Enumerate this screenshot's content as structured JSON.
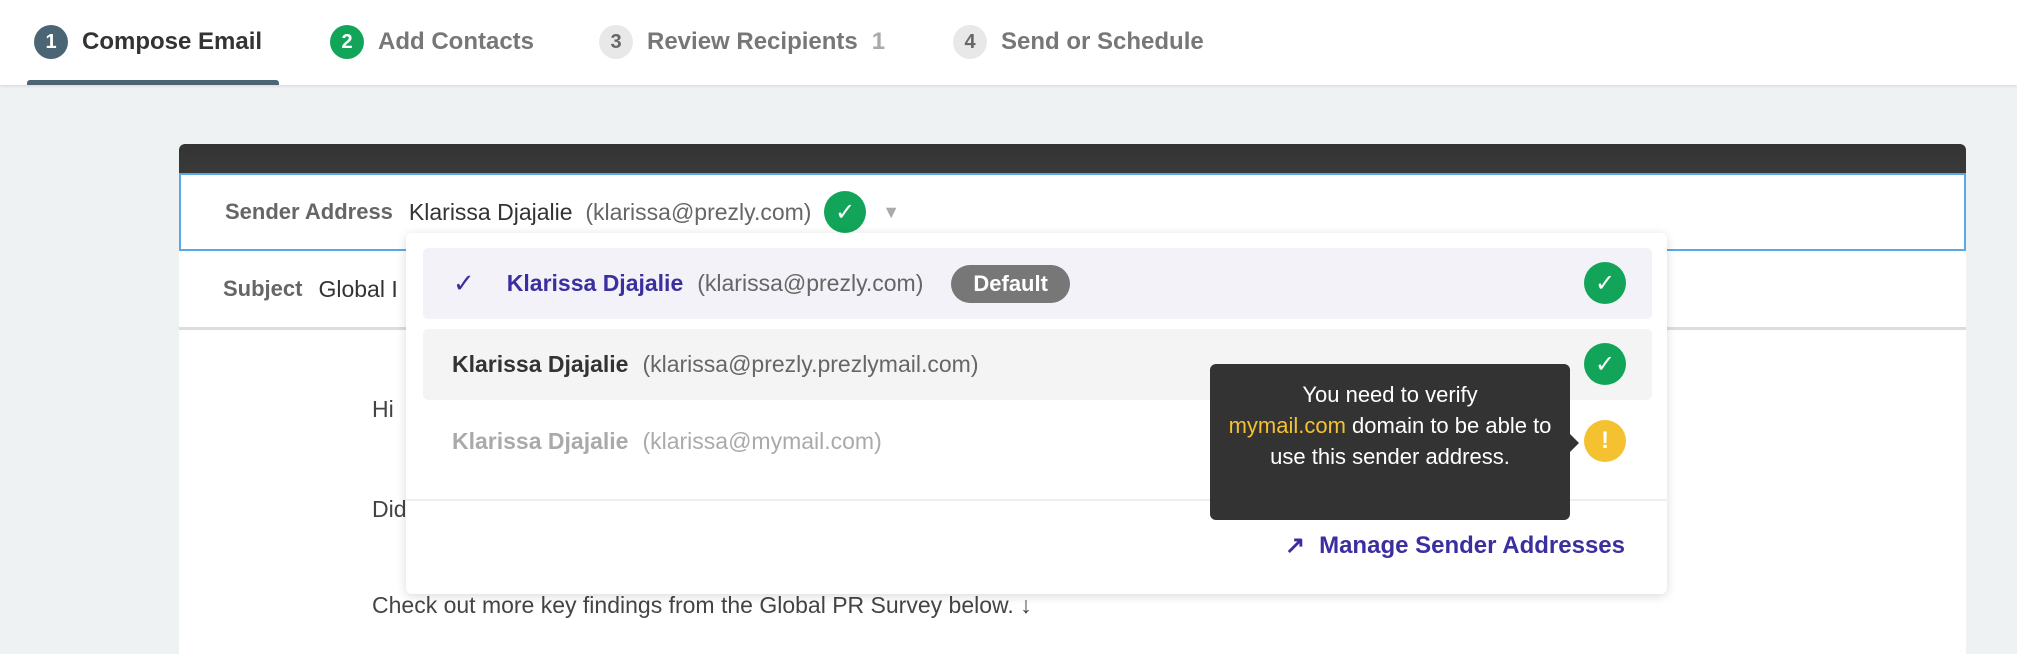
{
  "steps": [
    {
      "num": "1",
      "label": "Compose Email",
      "state": "active"
    },
    {
      "num": "2",
      "label": "Add Contacts",
      "state": "done"
    },
    {
      "num": "3",
      "label": "Review Recipients",
      "count": "1"
    },
    {
      "num": "4",
      "label": "Send or Schedule"
    }
  ],
  "sender": {
    "label": "Sender Address",
    "name": "Klarissa Djajalie",
    "email": "(klarissa@prezly.com)"
  },
  "subject": {
    "label": "Subject",
    "value": "Global I"
  },
  "body": {
    "line1": "Hi",
    "line2": "Did",
    "line3": "Check out more key findings from the Global PR Survey below. ↓"
  },
  "dropdown": {
    "items": [
      {
        "name": "Klarissa Djajalie",
        "email": "(klarissa@prezly.com)",
        "badge": "Default",
        "selected": true,
        "status": "verified"
      },
      {
        "name": "Klarissa Djajalie",
        "email": "(klarissa@prezly.prezlymail.com)",
        "status": "verified"
      },
      {
        "name": "Klarissa Djajalie",
        "email": "(klarissa@mymail.com)",
        "status": "warning"
      }
    ],
    "manage_label": "Manage Sender Addresses"
  },
  "tooltip": {
    "pre": "You need to verify",
    "domain": "mymail.com",
    "post": "domain to be able to use this sender address."
  },
  "colors": {
    "accent": "#3b2fa0",
    "success": "#12a55a",
    "warning": "#f4c230",
    "focus": "#5aa9e6"
  }
}
